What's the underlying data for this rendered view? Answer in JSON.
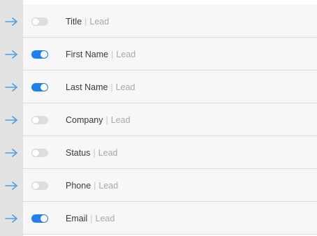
{
  "colors": {
    "accent": "#1e7ff0",
    "arrow": "#4b9fe8",
    "toggle_off": "#dedede"
  },
  "separator": "|",
  "rows": [
    {
      "field": "Title",
      "object": "Lead",
      "enabled": false,
      "arrow_icon": "arrow-right-icon"
    },
    {
      "field": "First Name",
      "object": "Lead",
      "enabled": true,
      "arrow_icon": "arrow-right-icon"
    },
    {
      "field": "Last Name",
      "object": "Lead",
      "enabled": true,
      "arrow_icon": "arrow-right-icon"
    },
    {
      "field": "Company",
      "object": "Lead",
      "enabled": false,
      "arrow_icon": "arrow-right-icon"
    },
    {
      "field": "Status",
      "object": "Lead",
      "enabled": false,
      "arrow_icon": "arrow-right-icon"
    },
    {
      "field": "Phone",
      "object": "Lead",
      "enabled": false,
      "arrow_icon": "arrow-right-icon"
    },
    {
      "field": "Email",
      "object": "Lead",
      "enabled": true,
      "arrow_icon": "arrow-right-icon"
    }
  ]
}
